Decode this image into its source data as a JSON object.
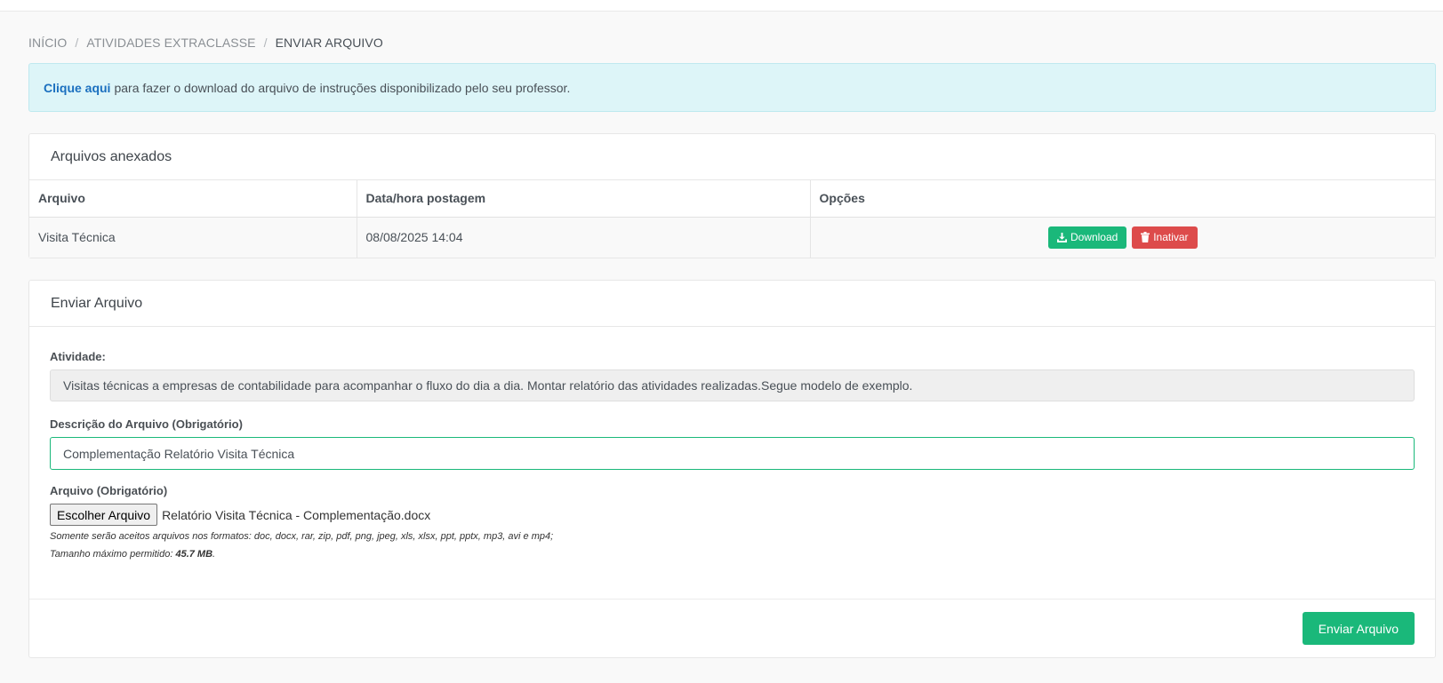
{
  "breadcrumb": {
    "items": [
      "INÍCIO",
      "ATIVIDADES EXTRACLASSE",
      "ENVIAR ARQUIVO"
    ],
    "separator": "/"
  },
  "alert": {
    "link_text": "Clique aqui",
    "text": "para fazer o download do arquivo de instruções disponibilizado pelo seu professor."
  },
  "attached": {
    "title": "Arquivos anexados",
    "columns": [
      "Arquivo",
      "Data/hora postagem",
      "Opções"
    ],
    "rows": [
      {
        "file": "Visita Técnica",
        "date": "08/08/2025 14:04"
      }
    ],
    "download_label": "Download",
    "inactivate_label": "Inativar"
  },
  "send": {
    "title": "Enviar Arquivo",
    "activity_label": "Atividade:",
    "activity_text": "Visitas técnicas a empresas de contabilidade para acompanhar o fluxo do dia a dia. Montar relatório das atividades realizadas.Segue modelo de exemplo.",
    "description_label": "Descrição do Arquivo (Obrigatório)",
    "description_value": "Complementação Relatório Visita Técnica",
    "file_label": "Arquivo (Obrigatório)",
    "choose_file_label": "Escolher Arquivo",
    "file_name": "Relatório Visita Técnica - Complementação.docx",
    "hint_formats": "Somente serão aceitos arquivos nos formatos: doc, docx, rar, zip, pdf, png, jpeg, xls, xlsx, ppt, pptx, mp3, avi e mp4;",
    "hint_size_prefix": "Tamanho máximo permitido:",
    "hint_size_value": "45.7 MB",
    "hint_size_suffix": ".",
    "submit_label": "Enviar Arquivo"
  },
  "colors": {
    "accent_green": "#1ab87a",
    "danger_red": "#dd4b4b",
    "alert_bg": "#ddf5f8",
    "link_blue": "#1a6fbf"
  }
}
